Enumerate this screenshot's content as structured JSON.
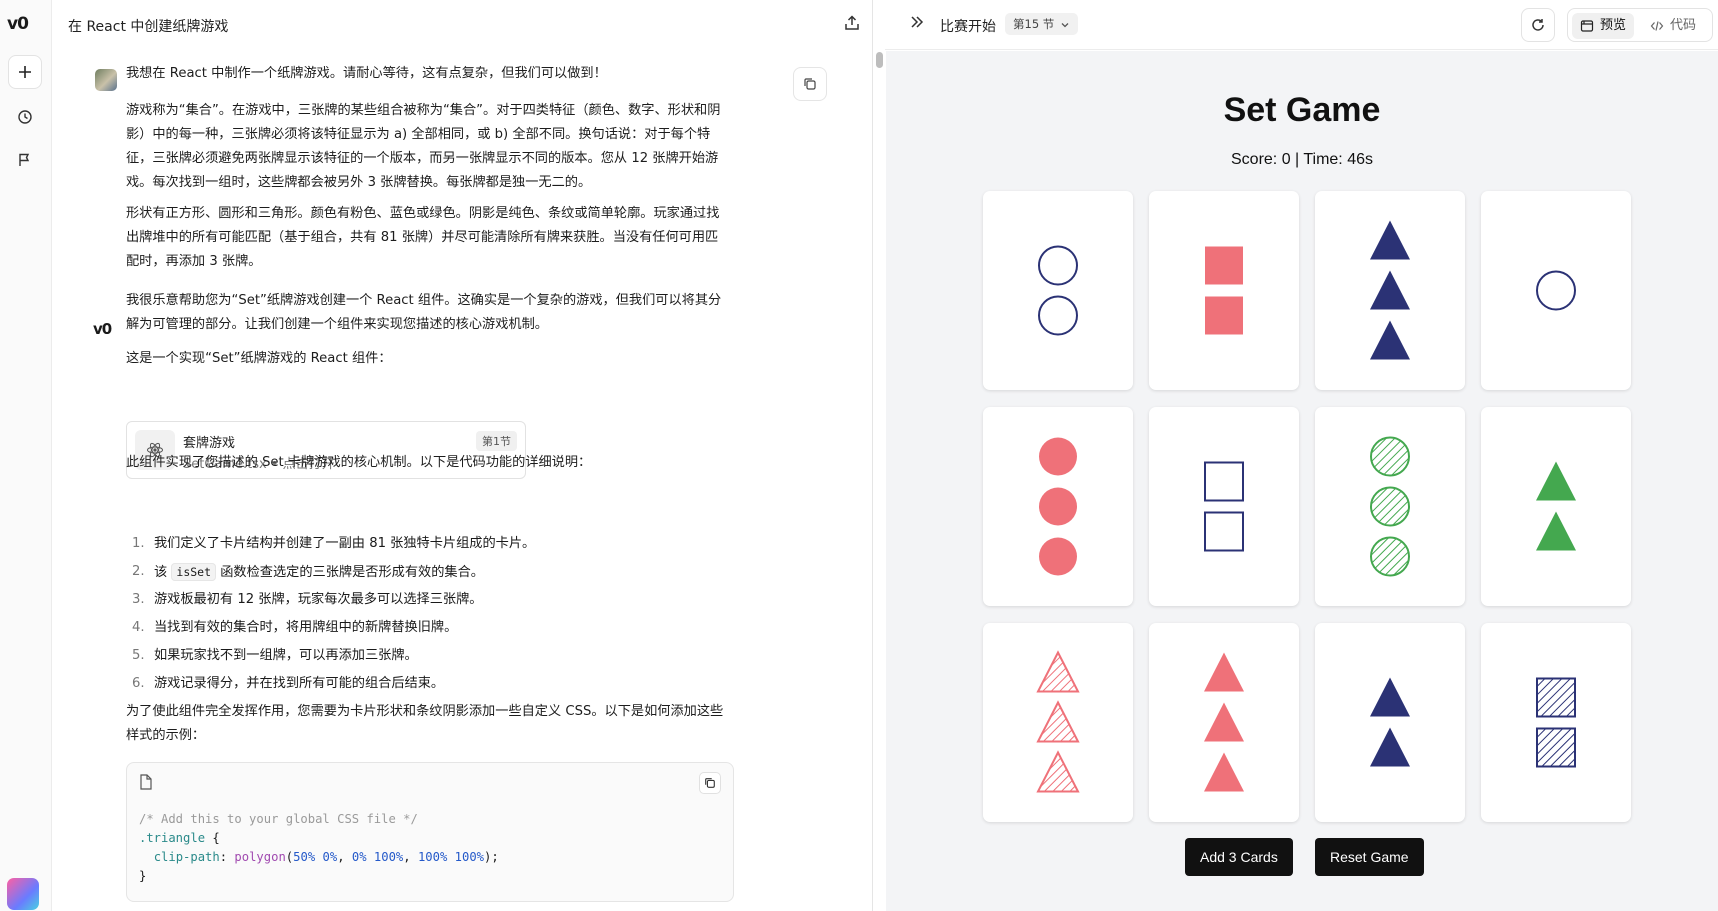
{
  "rail": {
    "logo": "v0",
    "new_icon": "plus-icon",
    "history_icon": "history-icon",
    "flag_icon": "flag-icon"
  },
  "chat": {
    "title": "在 React 中创建纸牌游戏",
    "user_message": {
      "p1": "我想在 React 中制作一个纸牌游戏。请耐心等待，这有点复杂，但我们可以做到！",
      "p2": "游戏称为“集合”。在游戏中，三张牌的某些组合被称为“集合”。对于四类特征（颜色、数字、形状和阴影）中的每一种，三张牌必须将该特征显示为 a) 全部相同，或 b) 全部不同。换句话说：对于每个特征，三张牌必须避免两张牌显示该特征的一个版本，而另一张牌显示不同的版本。您从 12 张牌开始游戏。每次找到一组时，这些牌都会被另外 3 张牌替换。每张牌都是独一无二的。",
      "p3": "形状有正方形、圆形和三角形。颜色有粉色、蓝色或绿色。阴影是纯色、条纹或简单轮廓。玩家通过找出牌堆中的所有可能匹配（基于组合，共有 81 张牌）并尽可能清除所有牌来获胜。当没有任何可用匹配时，再添加 3 张牌。"
    },
    "assistant": {
      "p1": "我很乐意帮助您为“Set”纸牌游戏创建一个 React 组件。这确实是一个复杂的游戏，但我们可以将其分解为可管理的部分。让我们创建一个组件来实现您描述的核心游戏机制。",
      "p2": "这是一个实现“Set”纸牌游戏的 React 组件：",
      "artifact": {
        "name": "套牌游戏",
        "sub": "SetGame.tsx • 点击打开",
        "badge": "第1节"
      },
      "p3": "此组件实现了您描述的 Set 卡牌游戏的核心机制。以下是代码功能的详细说明：",
      "list": [
        {
          "num": "1.",
          "text": "我们定义了卡片结构并创建了一副由 81 张独特卡片组成的卡片。"
        },
        {
          "num": "2.",
          "pre": "该",
          "code": "isSet",
          "post": "函数检查选定的三张牌是否形成有效的集合。"
        },
        {
          "num": "3.",
          "text": "游戏板最初有 12 张牌，玩家每次最多可以选择三张牌。"
        },
        {
          "num": "4.",
          "text": "当找到有效的集合时，将用牌组中的新牌替换旧牌。"
        },
        {
          "num": "5.",
          "text": "如果玩家找不到一组牌，可以再添加三张牌。"
        },
        {
          "num": "6.",
          "text": "游戏记录得分，并在找到所有可能的组合后结束。"
        }
      ],
      "p4": "为了使此组件完全发挥作用，您需要为卡片形状和条纹阴影添加一些自定义 CSS。以下是如何添加这些样式的示例：",
      "code": {
        "comment": "/* Add this to your global CSS file */",
        "selector": ".triangle",
        "open": " {",
        "prop": "clip-path",
        "fn": "polygon",
        "args": [
          "50%",
          "0%",
          "0%",
          "100%",
          "100%",
          "100%"
        ],
        "close": "}"
      }
    }
  },
  "preview": {
    "title": "比赛开始",
    "version": "第15 节",
    "tab_preview": "预览",
    "tab_code": "代码",
    "game": {
      "title": "Set Game",
      "score_line": "Score: 0 | Time: 46s",
      "add_button": "Add 3 Cards",
      "reset_button": "Reset Game"
    }
  },
  "cards": [
    {
      "shape": "circle",
      "color": "blue",
      "shading": "outline",
      "count": 2
    },
    {
      "shape": "square",
      "color": "pink",
      "shading": "solid",
      "count": 2
    },
    {
      "shape": "triangle",
      "color": "blue",
      "shading": "solid",
      "count": 3
    },
    {
      "shape": "circle",
      "color": "blue",
      "shading": "outline",
      "count": 1
    },
    {
      "shape": "circle",
      "color": "pink",
      "shading": "solid",
      "count": 3
    },
    {
      "shape": "square",
      "color": "blue",
      "shading": "outline",
      "count": 2
    },
    {
      "shape": "circle",
      "color": "green",
      "shading": "striped",
      "count": 3
    },
    {
      "shape": "triangle",
      "color": "green",
      "shading": "solid",
      "count": 2
    },
    {
      "shape": "triangle",
      "color": "pink",
      "shading": "striped",
      "count": 3
    },
    {
      "shape": "triangle",
      "color": "pink",
      "shading": "solid",
      "count": 3
    },
    {
      "shape": "triangle",
      "color": "blue",
      "shading": "solid",
      "count": 2
    },
    {
      "shape": "square",
      "color": "blue",
      "shading": "striped",
      "count": 2
    }
  ],
  "colors": {
    "blue": "#2b3275",
    "pink": "#ef7179",
    "green": "#44a84f"
  }
}
